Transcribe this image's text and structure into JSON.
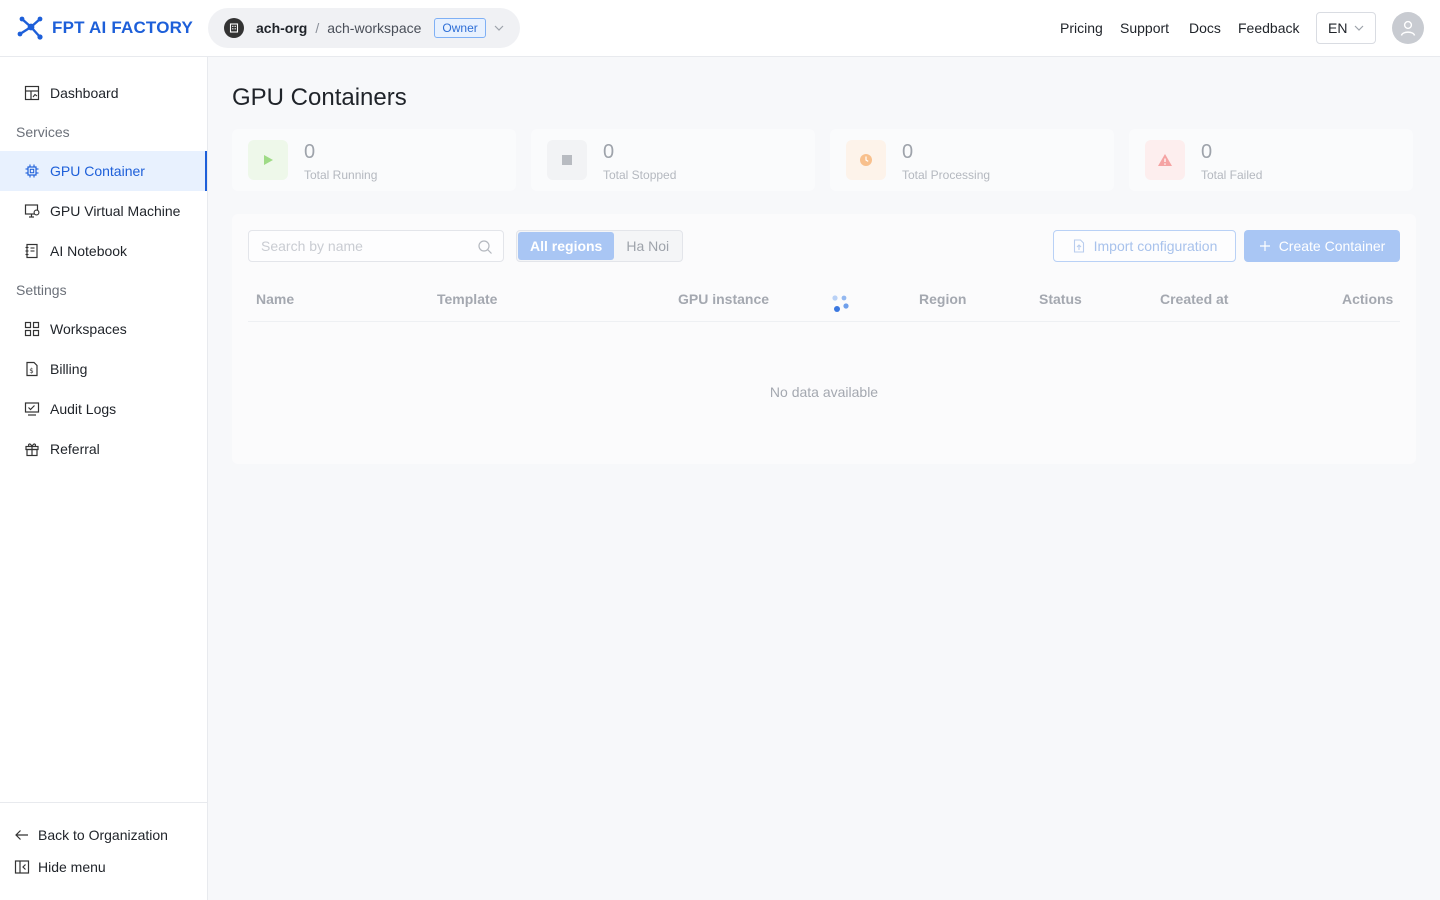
{
  "header": {
    "logo_text": "FPT AI FACTORY",
    "org_name": "ach-org",
    "separator": "/",
    "workspace_name": "ach-workspace",
    "role_badge": "Owner",
    "nav": [
      "Pricing",
      "Support",
      "Docs",
      "Feedback"
    ],
    "language": "EN"
  },
  "sidebar": {
    "dashboard": "Dashboard",
    "services_label": "Services",
    "services": [
      "GPU Container",
      "GPU Virtual Machine",
      "AI Notebook"
    ],
    "settings_label": "Settings",
    "settings": [
      "Workspaces",
      "Billing",
      "Audit Logs",
      "Referral"
    ],
    "back_label": "Back to Organization",
    "hide_label": "Hide menu",
    "active_item": "GPU Container"
  },
  "page": {
    "title": "GPU Containers"
  },
  "stats": [
    {
      "value": "0",
      "label": "Total Running",
      "icon": "play-icon",
      "color": "#52c41a"
    },
    {
      "value": "0",
      "label": "Total Stopped",
      "icon": "stop-icon",
      "color": "#8c8c8c"
    },
    {
      "value": "0",
      "label": "Total Processing",
      "icon": "clock-icon",
      "color": "#fa8c16"
    },
    {
      "value": "0",
      "label": "Total Failed",
      "icon": "warning-icon",
      "color": "#f5222d"
    }
  ],
  "toolbar": {
    "search_placeholder": "Search by name",
    "regions": [
      "All regions",
      "Ha Noi"
    ],
    "selected_region": "All regions",
    "import_label": "Import configuration",
    "create_label": "Create Container"
  },
  "table": {
    "columns": [
      "Name",
      "Template",
      "GPU instance",
      "Region",
      "Status",
      "Created at",
      "Actions"
    ],
    "empty_text": "No data available"
  },
  "colors": {
    "brand": "#1d5fd9",
    "primary_disabled": "#a9c6f4"
  }
}
